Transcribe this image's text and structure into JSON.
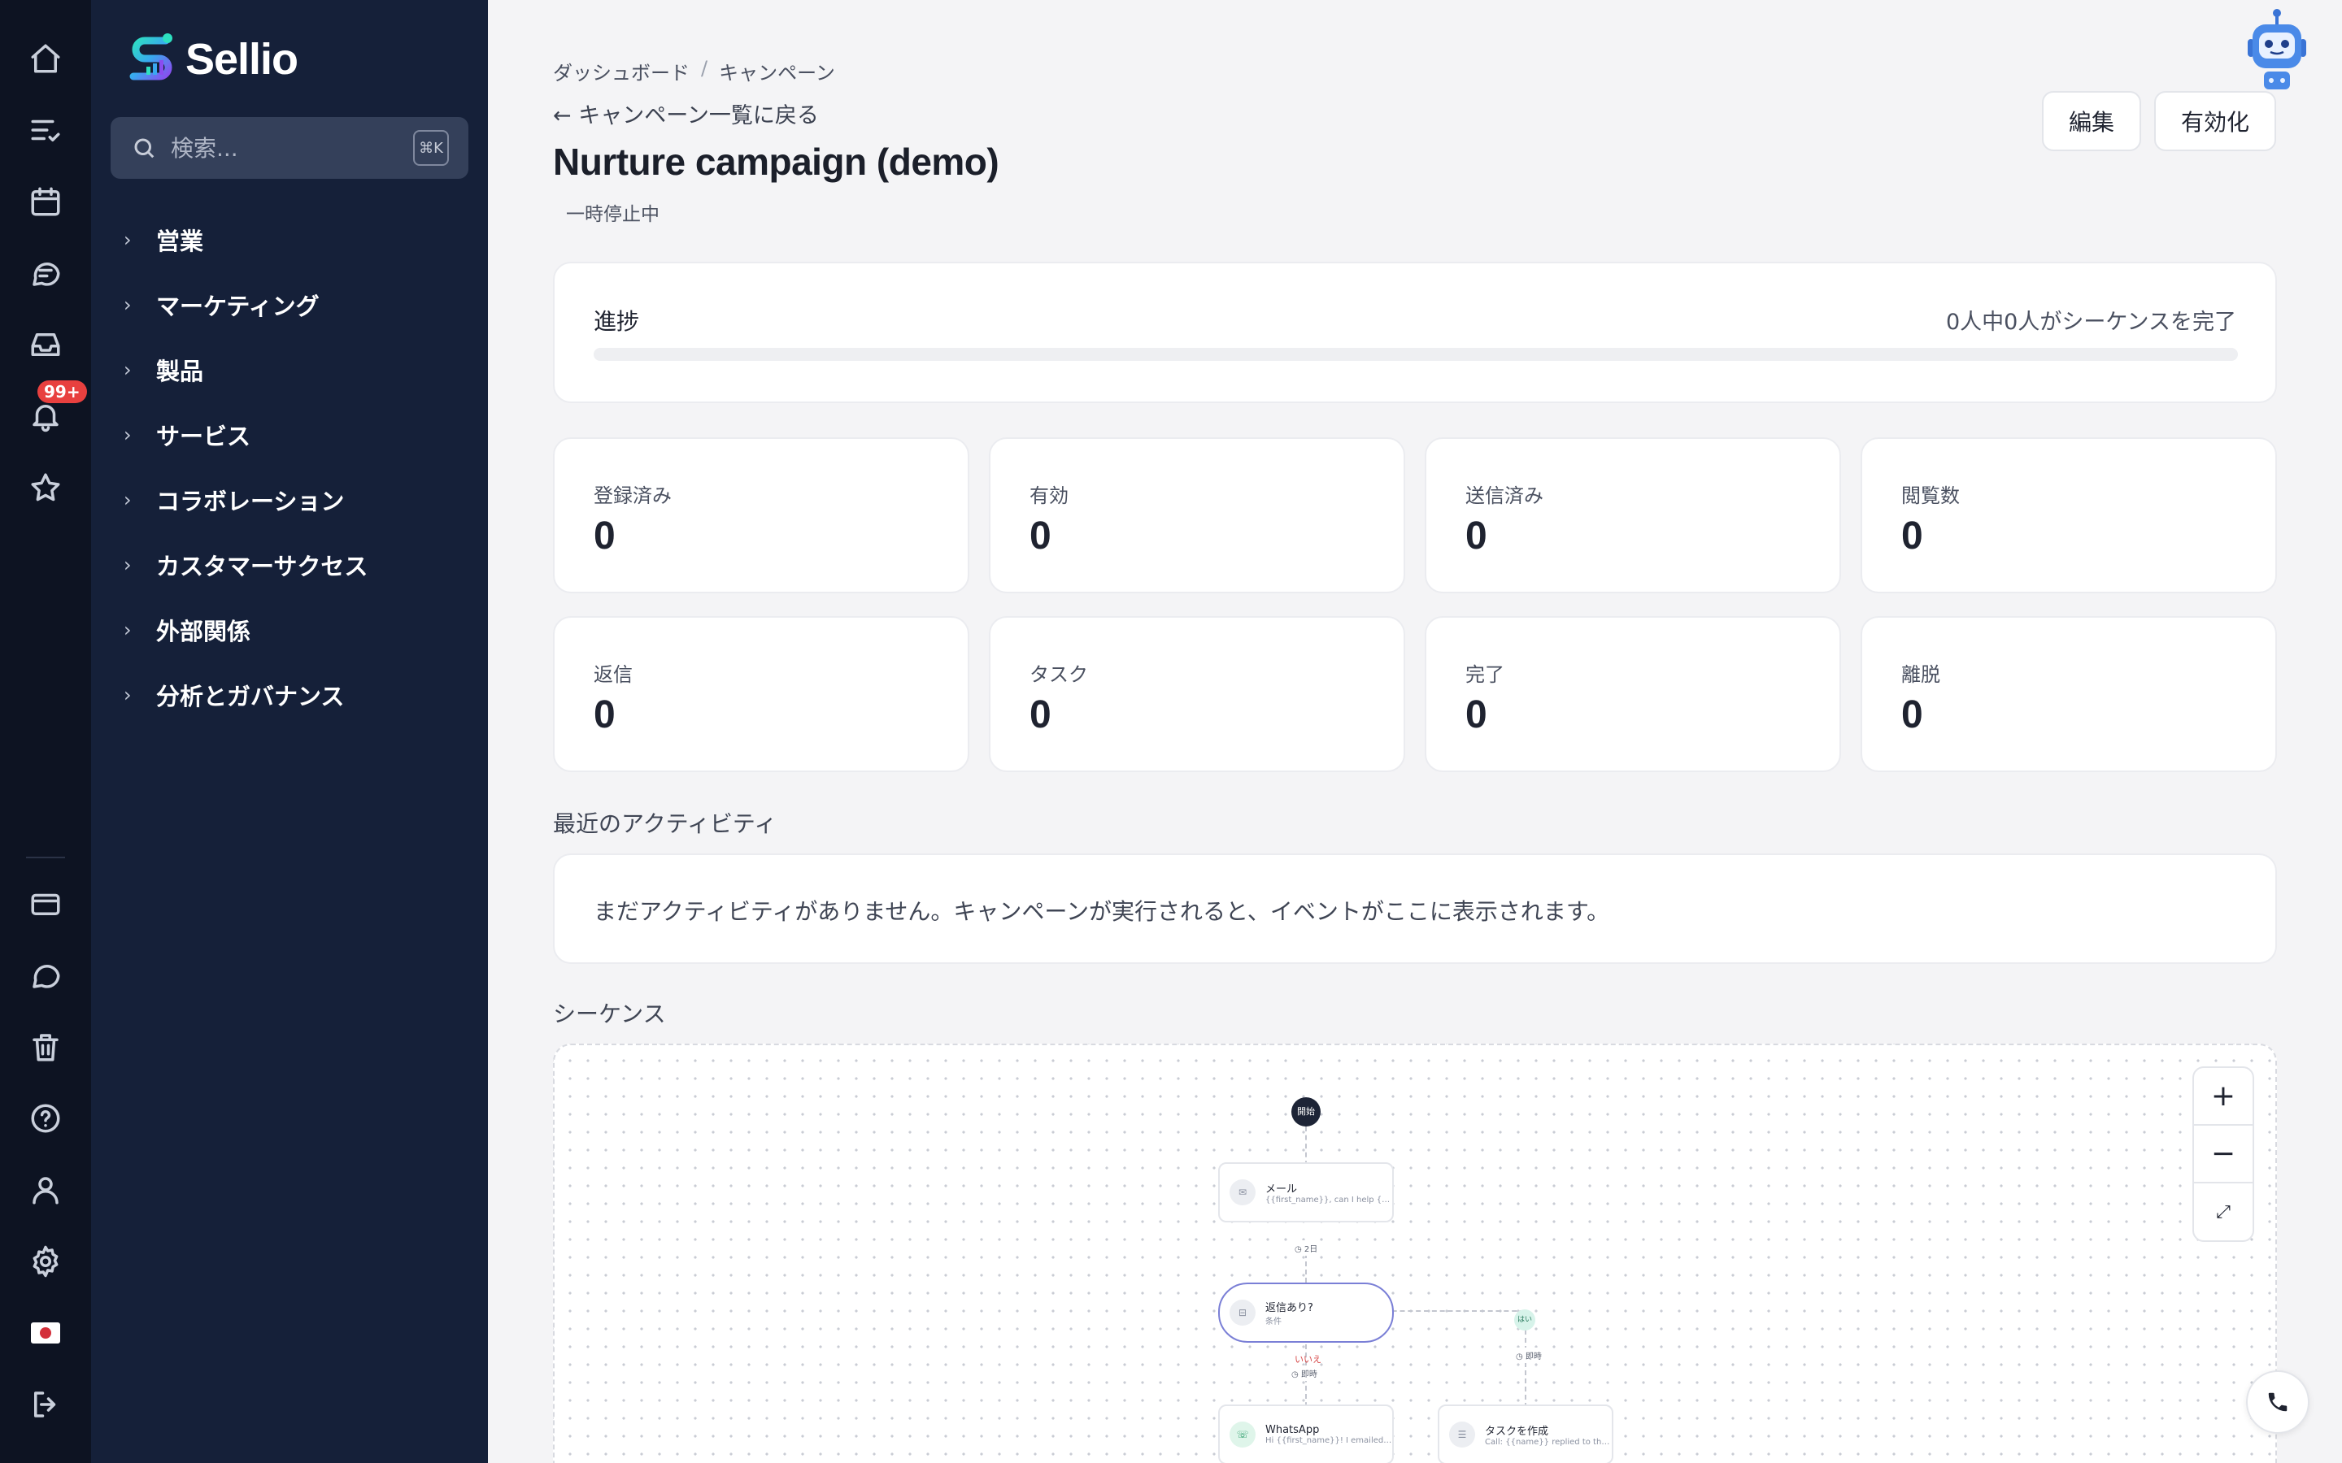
{
  "app": {
    "name": "Sellio"
  },
  "rail": {
    "notification_badge": "99+"
  },
  "sidebar": {
    "search_placeholder": "検索...",
    "search_shortcut": "⌘K",
    "items": [
      {
        "label": "営業"
      },
      {
        "label": "マーケティング"
      },
      {
        "label": "製品"
      },
      {
        "label": "サービス"
      },
      {
        "label": "コラボレーション"
      },
      {
        "label": "カスタマーサクセス"
      },
      {
        "label": "外部関係"
      },
      {
        "label": "分析とガバナンス"
      }
    ]
  },
  "header": {
    "breadcrumb": [
      "ダッシュボード",
      "キャンペーン"
    ],
    "breadcrumb_separator": "/",
    "back_link": "← キャンペーン一覧に戻る",
    "title": "Nurture campaign (demo)",
    "status": "一時停止中",
    "edit_label": "編集",
    "activate_label": "有効化"
  },
  "progress": {
    "label": "進捗",
    "summary": "0人中0人がシーケンスを完了",
    "completed_fraction": 0
  },
  "stats": [
    {
      "label": "登録済み",
      "value": "0"
    },
    {
      "label": "有効",
      "value": "0"
    },
    {
      "label": "送信済み",
      "value": "0"
    },
    {
      "label": "閲覧数",
      "value": "0"
    },
    {
      "label": "返信",
      "value": "0"
    },
    {
      "label": "タスク",
      "value": "0"
    },
    {
      "label": "完了",
      "value": "0"
    },
    {
      "label": "離脱",
      "value": "0"
    }
  ],
  "activity": {
    "heading": "最近のアクティビティ",
    "empty": "まだアクティビティがありません。キャンペーンが実行されると、イベントがここに表示されます。"
  },
  "sequence": {
    "heading": "シーケンス",
    "start_label": "開始",
    "zoom_in": "+",
    "zoom_out": "−",
    "fit": "⤢",
    "nodes": {
      "email": {
        "title": "メール",
        "subtitle": "{{first_name}}, can I help {{..."
      },
      "delay_1": "◷ 2日",
      "condition": {
        "title": "返信あり?",
        "subtitle": "条件"
      },
      "no_label": "いいえ",
      "yes_label": "はい",
      "delay_no": "◷ 即時",
      "delay_yes": "◷ 即時",
      "whatsapp": {
        "title": "WhatsApp",
        "subtitle": "Hi {{first_name}}! I emailed ..."
      },
      "task": {
        "title": "タスクを作成",
        "subtitle": "Call: {{name}} replied to the..."
      }
    }
  },
  "colors": {
    "rail_bg": "#0d1322",
    "sidebar_bg": "#152039",
    "accent": "#3b4cc0",
    "badge": "#e8403f"
  }
}
